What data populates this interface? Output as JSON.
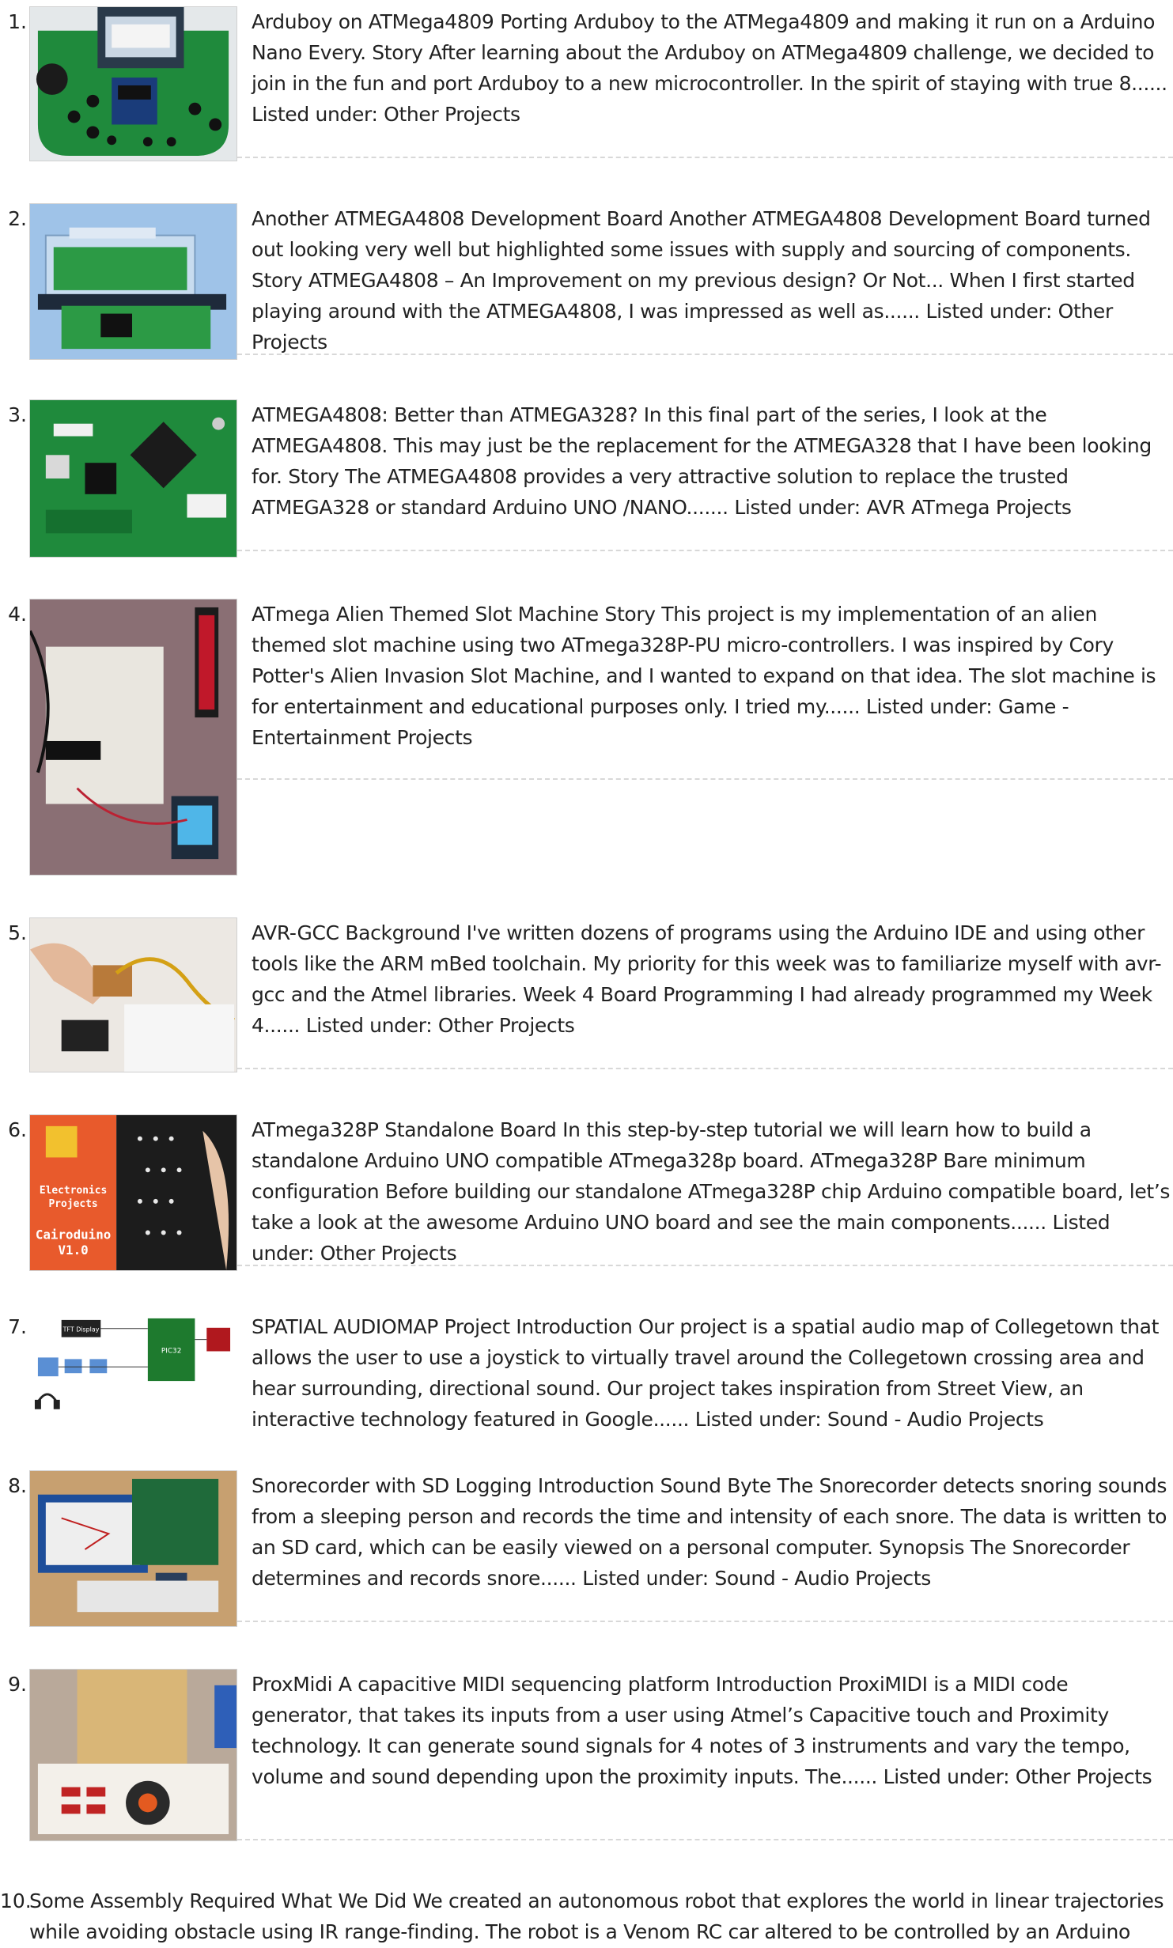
{
  "items": [
    {
      "number": "1.",
      "image_alt": "Arduboy handheld on green PCB",
      "text": "Arduboy on ATMega4809 Porting Arduboy to the ATMega4809 and making it run on a Arduino Nano Every. Story After learning about the Arduboy on ATMega4809 challenge, we decided to join in the fun and port Arduboy to a new microcontroller. In the spirit of staying with true 8...... Listed under: Other Projects"
    },
    {
      "number": "2.",
      "image_alt": "ATMEGA4808 development board in acrylic case",
      "text": "Another ATMEGA4808 Development Board Another ATMEGA4808 Development Board turned out looking very well but highlighted some issues with supply and sourcing of components. Story ATMEGA4808 – An Improvement on my previous design? Or Not... When I first started playing around with the ATMEGA4808, I was impressed as well as...... Listed under: Other Projects"
    },
    {
      "number": "3.",
      "image_alt": "Green ATMEGA4808 PCB close-up",
      "text": "ATMEGA4808: Better than ATMEGA328? In this final part of the series, I look at the ATMEGA4808. This may just be the replacement for the ATMEGA328 that I have been looking for. Story The ATMEGA4808 provides a very attractive solution to replace the trusted ATMEGA328 or standard Arduino UNO /NANO....... Listed under: AVR ATmega Projects"
    },
    {
      "number": "4.",
      "image_alt": "Breadboard slot machine with LED matrix and LCD",
      "text": "ATmega Alien Themed Slot Machine Story This project is my implementation of an alien themed slot machine using two ATmega328P-PU micro-controllers. I was inspired by Cory Potter's Alien Invasion Slot Machine, and I wanted to expand on that idea. The slot machine is for entertainment and educational purposes only. I tried my...... Listed under: Game - Entertainment Projects"
    },
    {
      "number": "5.",
      "image_alt": "Hand programming a small board",
      "text": "AVR-GCC Background I've written dozens of programs using the Arduino IDE and using other tools like the ARM mBed toolchain. My priority for this week was to familiarize myself with avr-gcc and the Atmel libraries. Week 4 Board Programming I had already programmed my Week 4...... Listed under: Other Projects"
    },
    {
      "number": "6.",
      "image_alt": "Electronics Projects Cairoduino V1.0 board",
      "thumb_title": "Electronics\nProjects",
      "thumb_subtitle": "Cairoduino\nV1.0",
      "text": "ATmega328P Standalone Board In this step-by-step tutorial we will learn how to build a standalone Arduino UNO compatible ATmega328p board. ATmega328P Bare minimum configuration Before building our standalone ATmega328P chip Arduino compatible board, let’s take a look at the awesome Arduino UNO board and see the main components...... Listed under: Other Projects"
    },
    {
      "number": "7.",
      "image_alt": "Spatial audio map block diagram",
      "thumb_labels": {
        "tft": "TFT Display",
        "mcu": "PIC32"
      },
      "text": "SPATIAL AUDIOMAP Project Introduction Our project is a spatial audio map of Collegetown that allows the user to use a joystick to virtually travel around the Collegetown crossing area and hear surrounding, directional sound. Our project takes inspiration from Street View, an interactive technology featured in Google...... Listed under: Sound - Audio Projects"
    },
    {
      "number": "8.",
      "image_alt": "Snorecorder breadboard and dev board",
      "text": "Snorecorder with SD Logging Introduction Sound Byte The Snorecorder detects snoring sounds from a sleeping person and records the time and intensity of each snore. The data is written to an SD card, which can be easily viewed on a personal computer. Synopsis The Snorecorder determines and records snore...... Listed under: Sound - Audio Projects"
    },
    {
      "number": "9.",
      "image_alt": "ProxiMIDI capacitive sensing platform",
      "text": "ProxMidi A capacitive MIDI sequencing platform Introduction ProxiMIDI is a MIDI code generator, that takes its inputs from a user using Atmel’s Capacitive touch and Proximity technology. It can generate sound signals for 4 notes of 3 instruments and vary the tempo, volume and sound depending upon the proximity inputs. The...... Listed under: Other Projects"
    },
    {
      "number": "10.",
      "text": "Some Assembly Required What We Did We created an autonomous robot that explores the world in linear trajectories while avoiding obstacle using IR range-finding. The robot is a Venom RC car altered to be controlled by an Arduino"
    }
  ],
  "colors": {
    "text": "#222222",
    "separator": "#d8d8d8",
    "pcb_green": "#1f8a3c",
    "sky_blue": "#9fc3e8",
    "orange": "#e85a2c"
  }
}
